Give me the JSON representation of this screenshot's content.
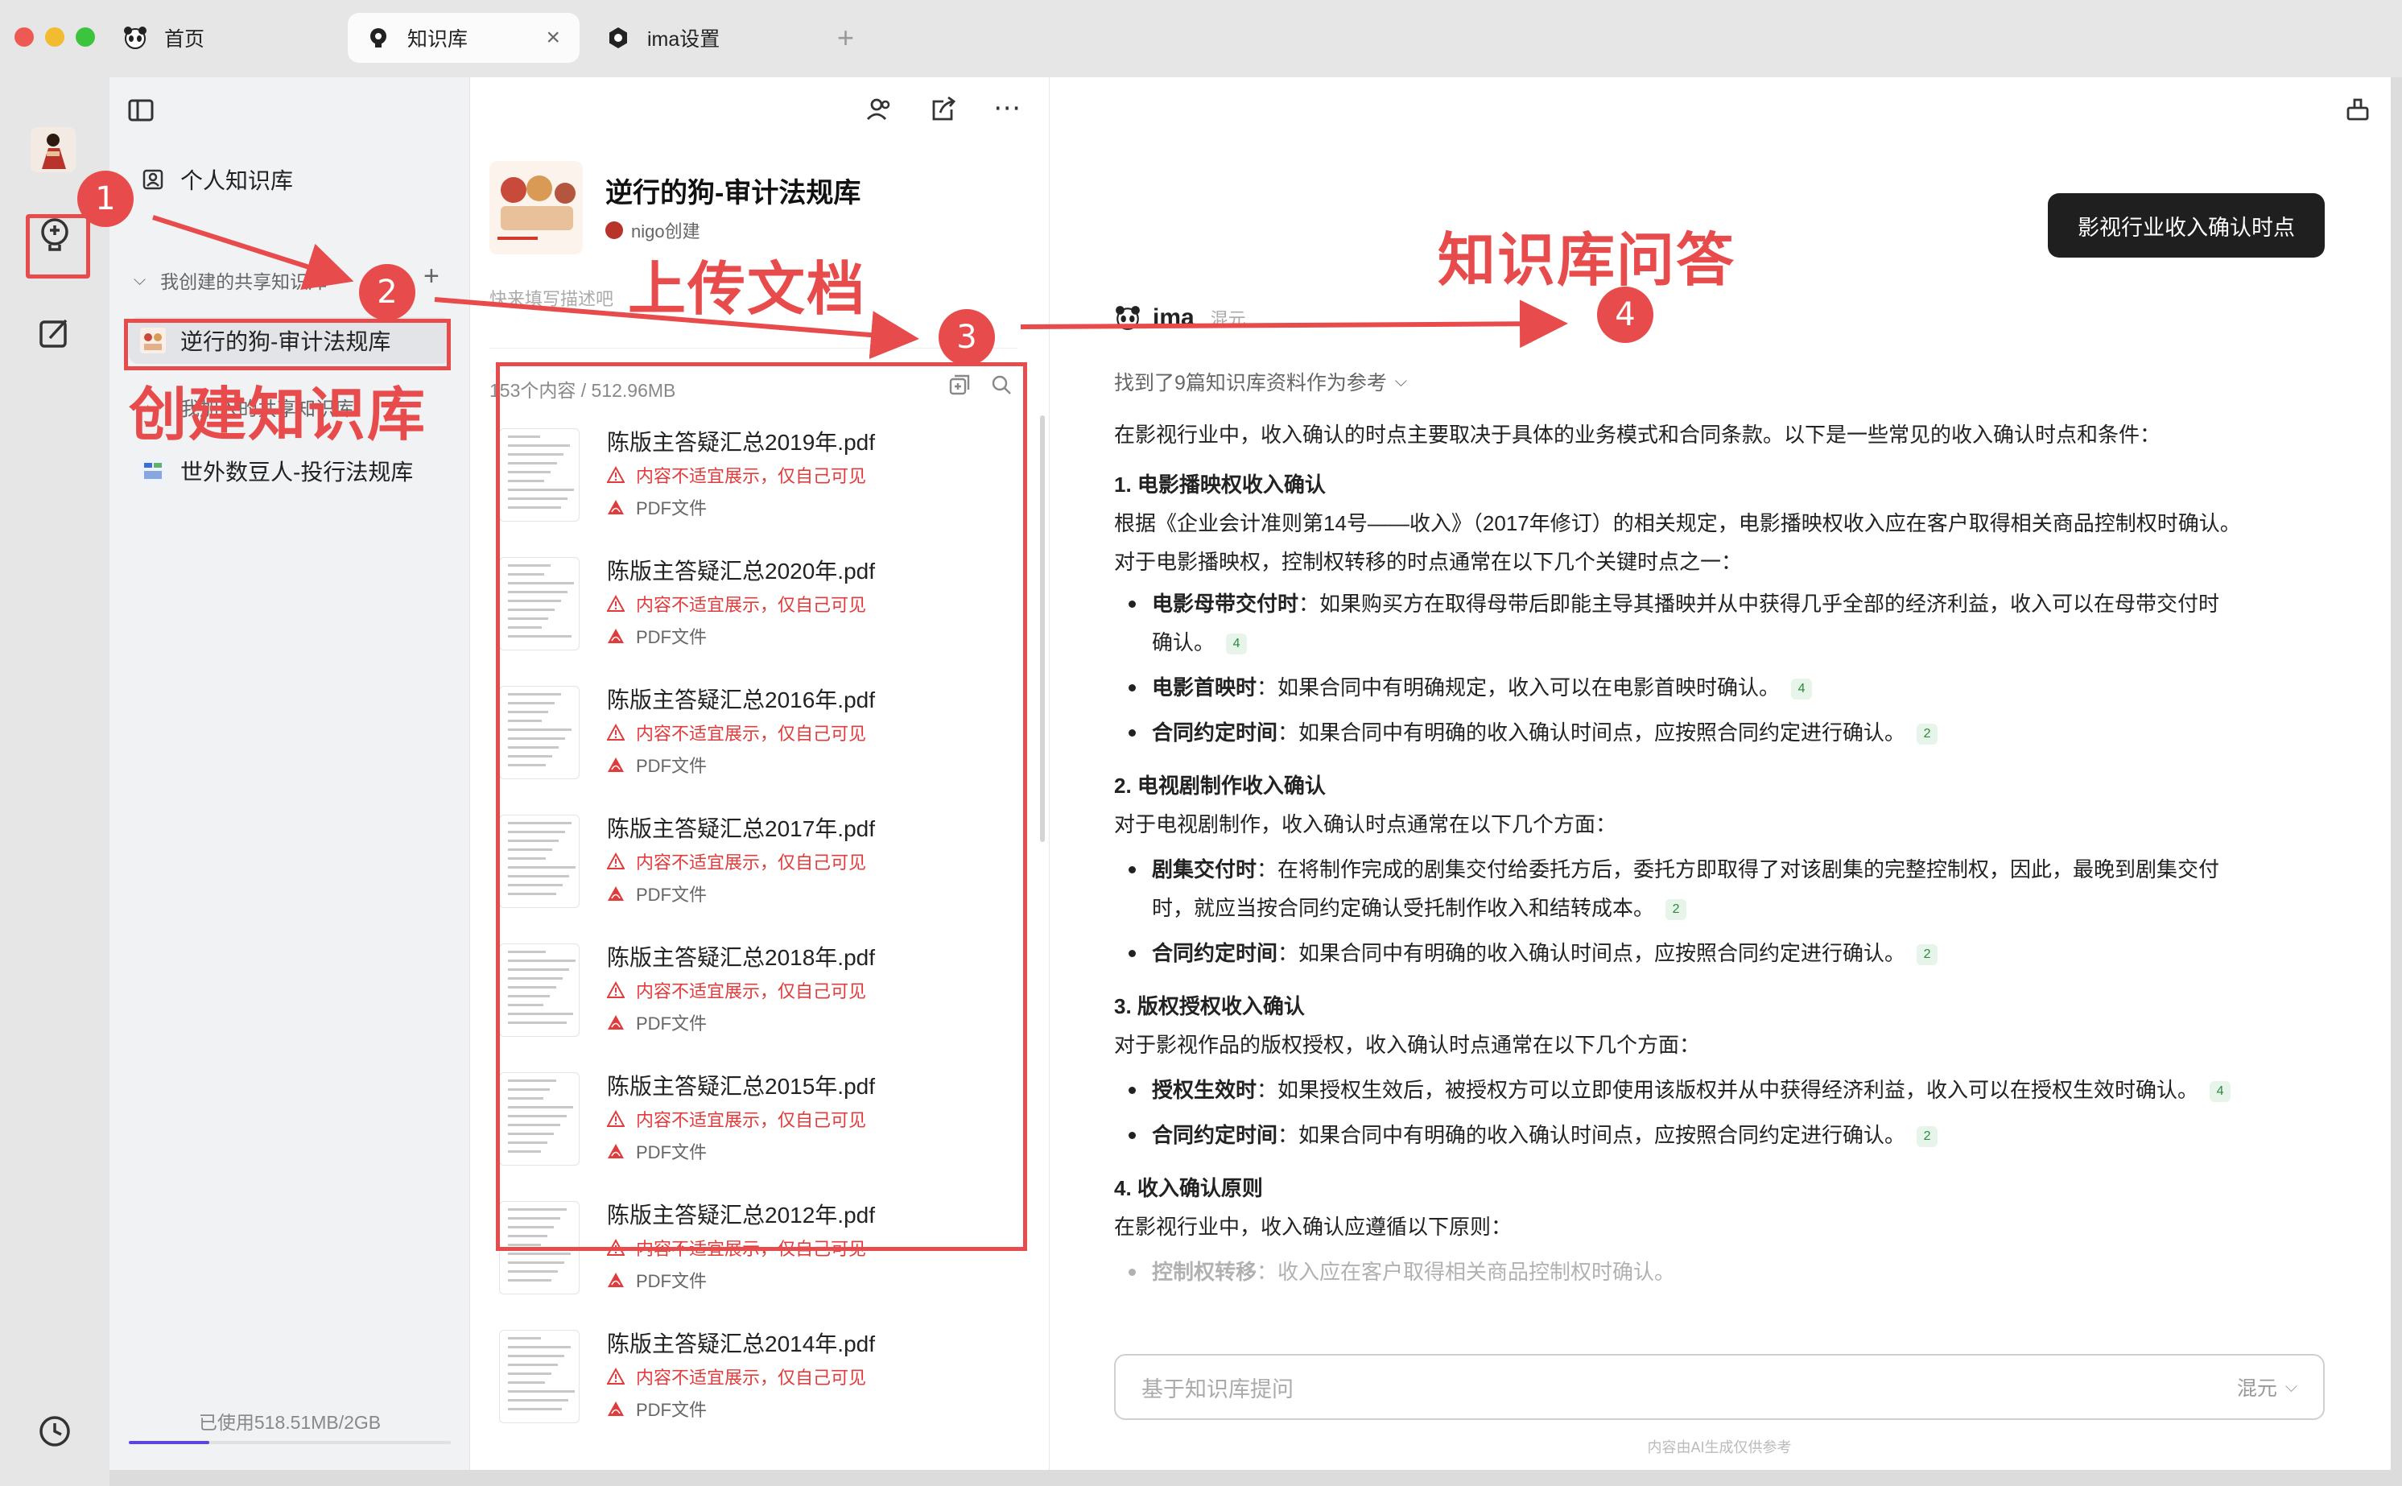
{
  "tabs": [
    {
      "label": "首页",
      "icon": "panda-icon"
    },
    {
      "label": "知识库",
      "icon": "bulb-icon"
    },
    {
      "label": "ima设置",
      "icon": "settings-icon"
    }
  ],
  "sidebar": {
    "personal_kb": "个人知识库",
    "shared_section": "我创建的共享知识库",
    "items": [
      {
        "label": "逆行的狗-审计法规库"
      },
      {
        "label": "我加入的共享知识库"
      },
      {
        "label": "世外数豆人-投行法规库"
      }
    ],
    "storage": "已使用518.51MB/2GB",
    "storage_fraction": 0.25
  },
  "kb": {
    "title": "逆行的狗-审计法规库",
    "creator": "nigo创建",
    "desc_placeholder": "快来填写描述吧",
    "stats": "153个内容 / 512.96MB",
    "warning": "内容不适宜展示，仅自己可见",
    "file_type": "PDF文件",
    "docs": [
      "陈版主答疑汇总2019年.pdf",
      "陈版主答疑汇总2020年.pdf",
      "陈版主答疑汇总2016年.pdf",
      "陈版主答疑汇总2017年.pdf",
      "陈版主答疑汇总2018年.pdf",
      "陈版主答疑汇总2015年.pdf",
      "陈版主答疑汇总2012年.pdf",
      "陈版主答疑汇总2014年.pdf"
    ]
  },
  "chat": {
    "question": "影视行业收入确认时点",
    "bot_name": "ima",
    "model": "混元",
    "refs_found": "找到了9篇知识库资料作为参考",
    "intro": "在影视行业中，收入确认的时点主要取决于具体的业务模式和合同条款。以下是一些常见的收入确认时点和条件：",
    "s1_title": "1. 电影播映权收入确认",
    "s1_p1": "根据《企业会计准则第14号——收入》（2017年修订）的相关规定，电影播映权收入应在客户取得相关商品控制权时确认。",
    "s1_p2": "对于电影播映权，控制权转移的时点通常在以下几个关键时点之一：",
    "s1_b1_term": "电影母带交付时",
    "s1_b1_text": "：如果购买方在取得母带后即能主导其播映并从中获得几乎全部的经济利益，收入可以在母带交付时",
    "s1_b1_cont": "确认。",
    "s1_b1_ref": "4",
    "s1_b2_term": "电影首映时",
    "s1_b2_text": "：如果合同中有明确规定，收入可以在电影首映时确认。",
    "s1_b2_ref": "4",
    "s1_b3_term": "合同约定时间",
    "s1_b3_text": "：如果合同中有明确的收入确认时间点，应按照合同约定进行确认。",
    "s1_b3_ref": "2",
    "s2_title": "2. 电视剧制作收入确认",
    "s2_p1": "对于电视剧制作，收入确认时点通常在以下几个方面：",
    "s2_b1_term": "剧集交付时",
    "s2_b1_text": "：在将制作完成的剧集交付给委托方后，委托方即取得了对该剧集的完整控制权，因此，最晚到剧集交付",
    "s2_b1_cont": "时，就应当按合同约定确认受托制作收入和结转成本。",
    "s2_b1_ref": "2",
    "s2_b2_term": "合同约定时间",
    "s2_b2_text": "：如果合同中有明确的收入确认时间点，应按照合同约定进行确认。",
    "s2_b2_ref": "2",
    "s3_title": "3. 版权授权收入确认",
    "s3_p1": "对于影视作品的版权授权，收入确认时点通常在以下几个方面：",
    "s3_b1_term": "授权生效时",
    "s3_b1_text": "：如果授权生效后，被授权方可以立即使用该版权并从中获得经济利益，收入可以在授权生效时确认。",
    "s3_b1_ref": "4",
    "s3_b2_term": "合同约定时间",
    "s3_b2_text": "：如果合同中有明确的收入确认时间点，应按照合同约定进行确认。",
    "s3_b2_ref": "2",
    "s4_title": "4. 收入确认原则",
    "s4_p1": "在影视行业中，收入确认应遵循以下原则：",
    "s4_b1_term": "控制权转移",
    "s4_b1_text": "：收入应在客户取得相关商品控制权时确认。",
    "input_placeholder": "基于知识库提问",
    "input_model": "混元",
    "disclaimer": "内容由AI生成仅供参考"
  },
  "annotations": {
    "step1": "1",
    "step2": "2",
    "step3": "3",
    "step4": "4",
    "label_create": "创建知识库",
    "label_upload": "上传文档",
    "label_qa": "知识库问答"
  },
  "colors": {
    "annotation": "#e84b4b",
    "warning": "#e23b3b",
    "progress": "#5b45e0",
    "question_bg": "#1f1f1f"
  }
}
